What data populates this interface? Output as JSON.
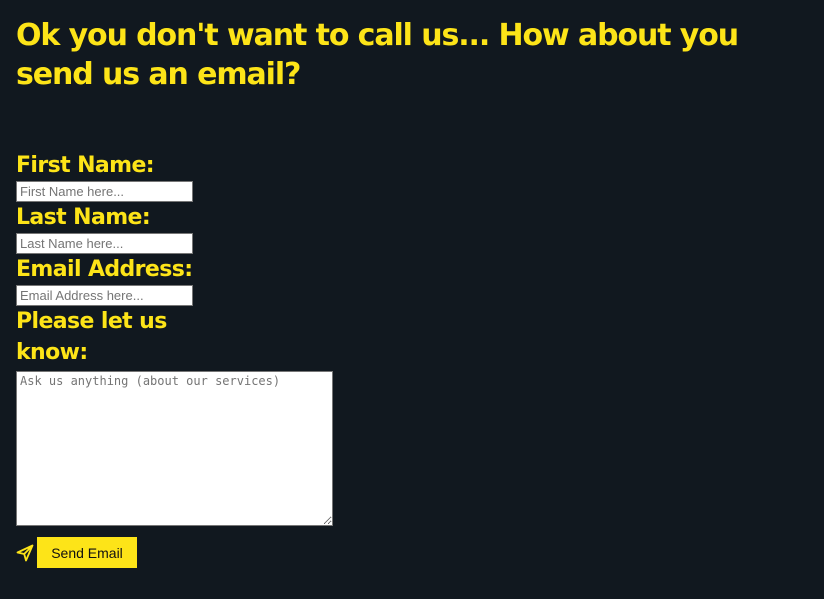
{
  "heading": "Ok you don't want to call us... How about you send us an email?",
  "form": {
    "first_name": {
      "label": "First Name:",
      "placeholder": "First Name here..."
    },
    "last_name": {
      "label": "Last Name:",
      "placeholder": "Last Name here..."
    },
    "email": {
      "label": "Email Address:",
      "placeholder": "Email Address here..."
    },
    "message": {
      "label": "Please let us know:",
      "placeholder": "Ask us anything (about our services)"
    },
    "send_label": "Send Email",
    "send_icon": "paper-plane-icon"
  },
  "colors": {
    "background": "#11181f",
    "accent": "#fde418"
  }
}
